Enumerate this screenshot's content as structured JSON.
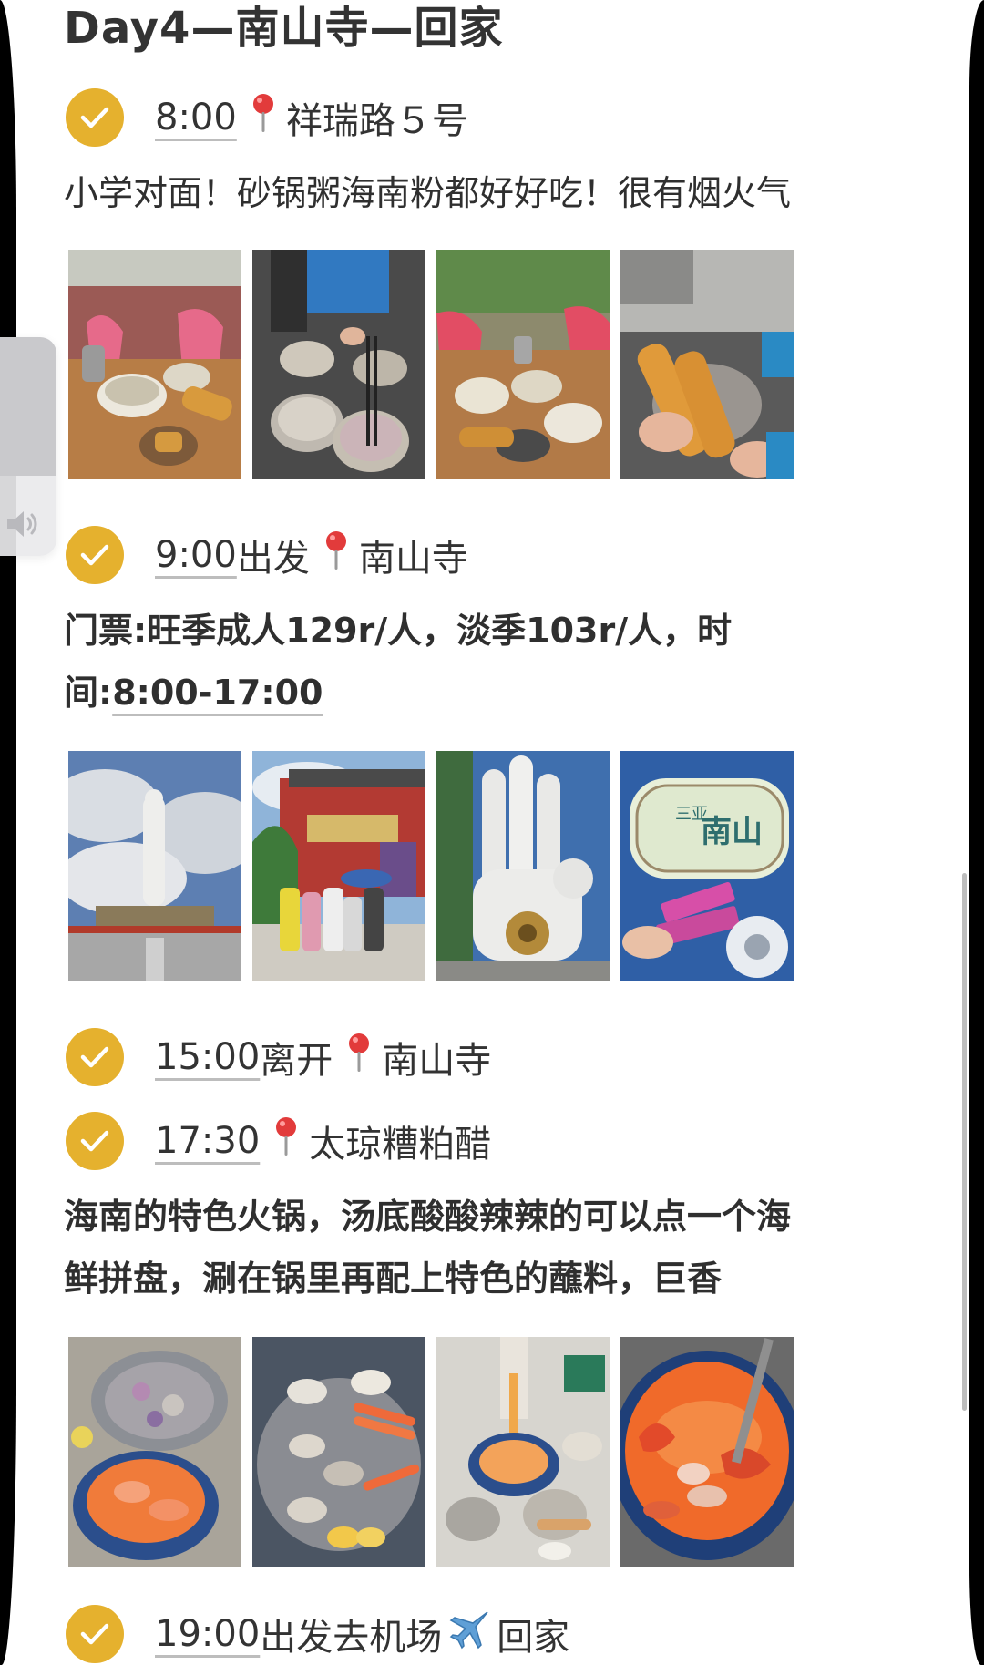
{
  "title": "Day4—南山寺—回家",
  "steps": [
    {
      "time": "8:00",
      "after_time": "",
      "place": "祥瑞路５号"
    },
    {
      "time": "9:00",
      "after_time": "出发",
      "place": "南山寺"
    },
    {
      "time": "15:00",
      "after_time": "离开",
      "place": "南山寺"
    },
    {
      "time": "17:30",
      "after_time": "",
      "place": "太琼糟粕醋"
    },
    {
      "time": "19:00",
      "after_time": "出发去机场",
      "place": "回家"
    }
  ],
  "descriptions": {
    "breakfast": "小学对面！砂锅粥海南粉都好好吃！很有烟火气",
    "temple_line1": "门票:旺季成人129r/人，淡季103r/人，时",
    "temple_line2_prefix": "间:",
    "temple_hours": "8:00-17:00",
    "dinner_line1": "海南的特色火锅，汤底酸酸辣辣的可以点一个海",
    "dinner_line2": "鲜拼盘，涮在锅里再配上特色的蘸料，巨香"
  },
  "photo_sign": {
    "sign_top": "三亚",
    "sign_main": "南山"
  },
  "icons": {
    "check": "check-circle-icon",
    "pin": "location-pin-icon",
    "plane": "airplane-icon",
    "speaker": "speaker-icon"
  },
  "colors": {
    "check": "#e5b12e",
    "pin": "#e23b3b",
    "text": "#2e2e2e",
    "underline": "#bdbdbd"
  }
}
